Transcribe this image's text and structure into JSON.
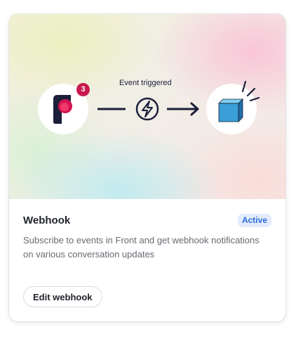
{
  "integration": {
    "hero": {
      "flow_label": "Event triggered",
      "app_badge_count": "3",
      "source_icon": "front-logo-icon",
      "trigger_icon": "lightning-bolt-icon",
      "target_icon": "cube-icon"
    },
    "title": "Webhook",
    "status": "Active",
    "description": "Subscribe to events in Front and get webhook notifications on various conversation updates",
    "edit_button_label": "Edit webhook"
  },
  "colors": {
    "badge": "#c8194f",
    "status_text": "#2e6bd6",
    "status_bg": "#e3ecfd",
    "navy": "#1b1f3a",
    "cube": "#3a9fd6"
  }
}
